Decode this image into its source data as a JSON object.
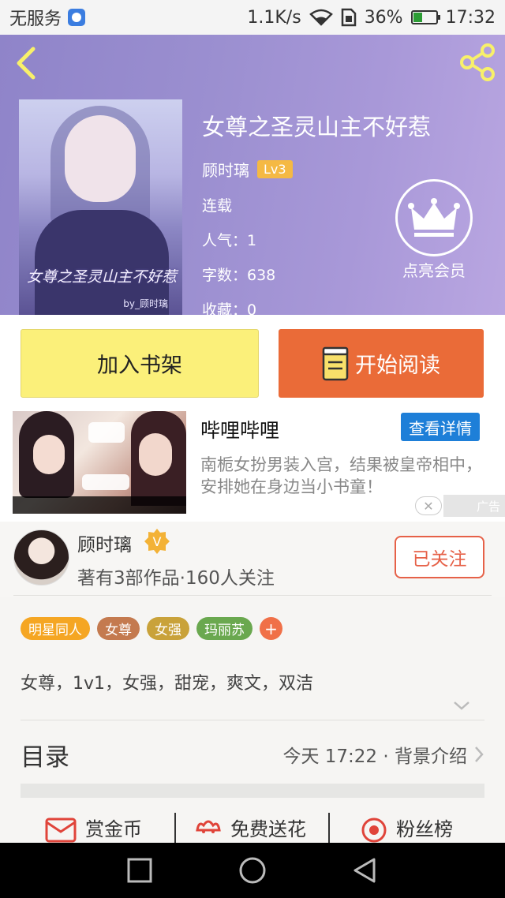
{
  "status_bar": {
    "carrier": "无服务",
    "speed": "1.1K/s",
    "battery": "36%",
    "time": "17:32"
  },
  "book": {
    "cover_title": "女尊之圣灵山主不好惹",
    "cover_author": "by_顾时璃",
    "title": "女尊之圣灵山主不好惹",
    "author": "顾时璃",
    "level": "Lv3",
    "status": "连载",
    "popularity": "人气：1",
    "word_count": "字数：638",
    "favorites": "收藏：0"
  },
  "vip": {
    "label": "点亮会员"
  },
  "actions_main": {
    "add_shelf": "加入书架",
    "start_reading": "开始阅读"
  },
  "ad": {
    "title": "哔哩哔哩",
    "detail_button": "查看详情",
    "description": "南栀女扮男装入宫，结果被皇帝相中，安排她在身边当小书童！",
    "label": "广告"
  },
  "author_card": {
    "name": "顾时璃",
    "stats": "著有3部作品·160人关注",
    "follow": "已关注"
  },
  "tags": [
    {
      "label": "明星同人",
      "color": "#f5a623"
    },
    {
      "label": "女尊",
      "color": "#c47a4f"
    },
    {
      "label": "女强",
      "color": "#c9a23a"
    },
    {
      "label": "玛丽苏",
      "color": "#6aa84f"
    }
  ],
  "description": "女尊，1v1，女强，甜宠，爽文，双洁",
  "toc": {
    "title": "目录",
    "latest": "今天 17:22 · 背景介绍"
  },
  "bottom_actions": {
    "reward": "赏金币",
    "flowers": "免费送花",
    "fans": "粉丝榜"
  },
  "colors": {
    "header_purple": "#9b8fd0",
    "add_shelf_yellow": "#fbf07a",
    "read_orange": "#ea6b38",
    "follow_red": "#e66148",
    "ad_blue": "#1e7fd8"
  }
}
